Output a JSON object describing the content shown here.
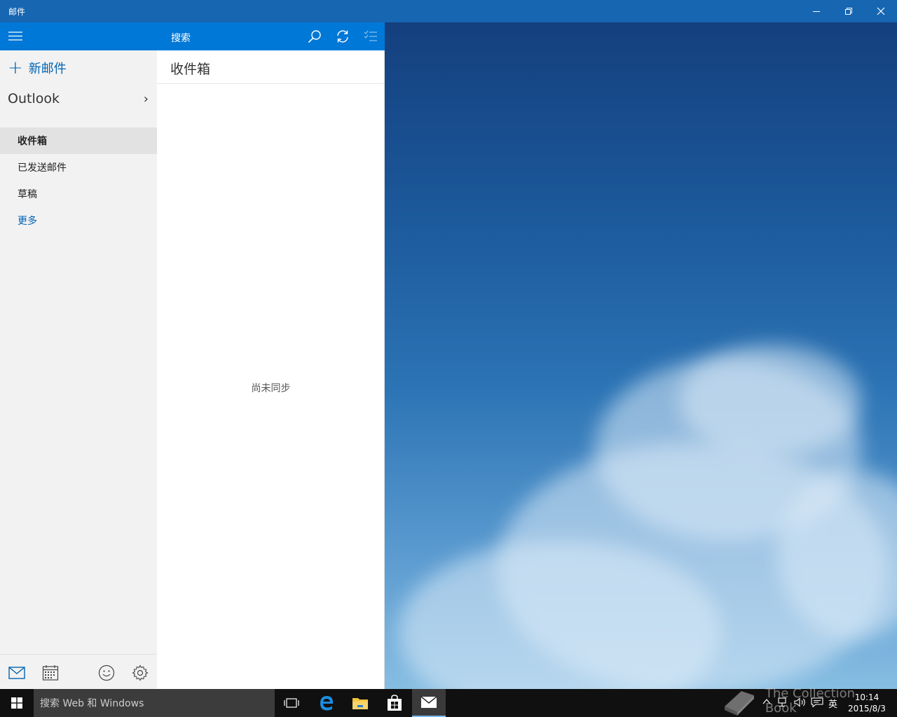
{
  "window": {
    "title": "邮件"
  },
  "sidebar": {
    "new_mail_label": "新邮件",
    "account_name": "Outlook",
    "folders": [
      {
        "label": "收件箱",
        "active": true
      },
      {
        "label": "已发送邮件",
        "active": false
      },
      {
        "label": "草稿",
        "active": false
      },
      {
        "label": "更多",
        "active": false
      }
    ],
    "bottom_icons": [
      "mail-icon",
      "calendar-icon",
      "feedback-smiley-icon",
      "settings-gear-icon"
    ]
  },
  "message_list": {
    "search_label": "搜索",
    "folder_heading": "收件箱",
    "empty_state": "尚未同步"
  },
  "taskbar": {
    "search_placeholder": "搜索 Web 和 Windows",
    "ime_indicator": "英",
    "time": "10:14",
    "date": "2015/8/3"
  },
  "watermark": {
    "text": "The Collection Book"
  },
  "colors": {
    "titlebar": "#1666b2",
    "accent": "#0078d7",
    "link": "#0063b1",
    "sidebar_bg": "#f2f2f2",
    "taskbar_bg": "#101010"
  }
}
